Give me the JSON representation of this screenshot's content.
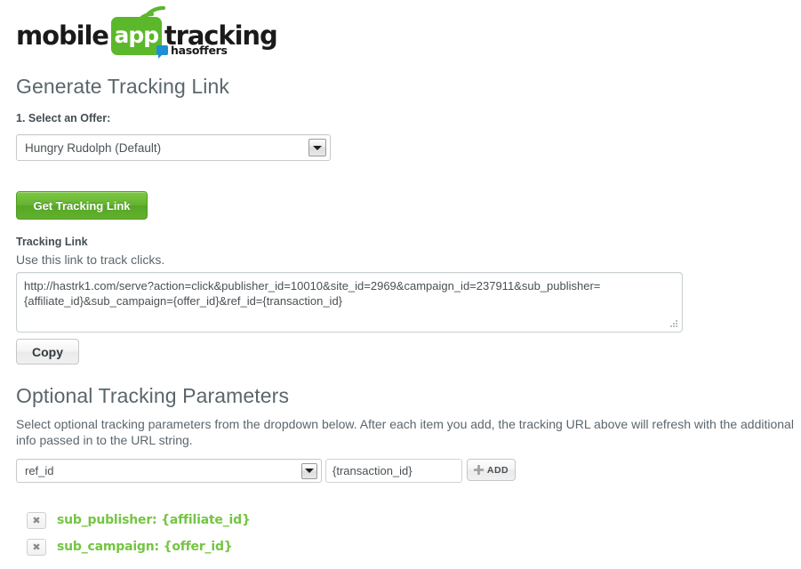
{
  "logo": {
    "word1": "mobile",
    "word2": "app",
    "word3": "tracking",
    "sub_brand": "hasoffers",
    "green": "#5cb82b",
    "blue": "#1e8fd5"
  },
  "headings": {
    "generate": "Generate Tracking Link",
    "optional": "Optional Tracking Parameters"
  },
  "offer": {
    "step_label": "1. Select an Offer:",
    "selected": "Hungry Rudolph (Default)"
  },
  "buttons": {
    "get_tracking_link": "Get Tracking Link",
    "copy": "Copy",
    "add": "ADD"
  },
  "tracking": {
    "label": "Tracking Link",
    "help": "Use this link to track clicks.",
    "url": "http://hastrk1.com/serve?action=click&publisher_id=10010&site_id=2969&campaign_id=237911&sub_publisher={affiliate_id}&sub_campaign={offer_id}&ref_id={transaction_id}"
  },
  "optional": {
    "help": "Select optional tracking parameters from the dropdown below. After each item you add, the tracking URL above will refresh with the additional info passed in to the URL string.",
    "param_selected": "ref_id",
    "param_value": "{transaction_id}",
    "param_value_placeholder": "",
    "added_params": [
      {
        "name": "sub_publisher: {affiliate_id}",
        "remove_glyph": "✖"
      },
      {
        "name": "sub_campaign: {offer_id}",
        "remove_glyph": "✖"
      }
    ],
    "accent": "#74c543"
  }
}
